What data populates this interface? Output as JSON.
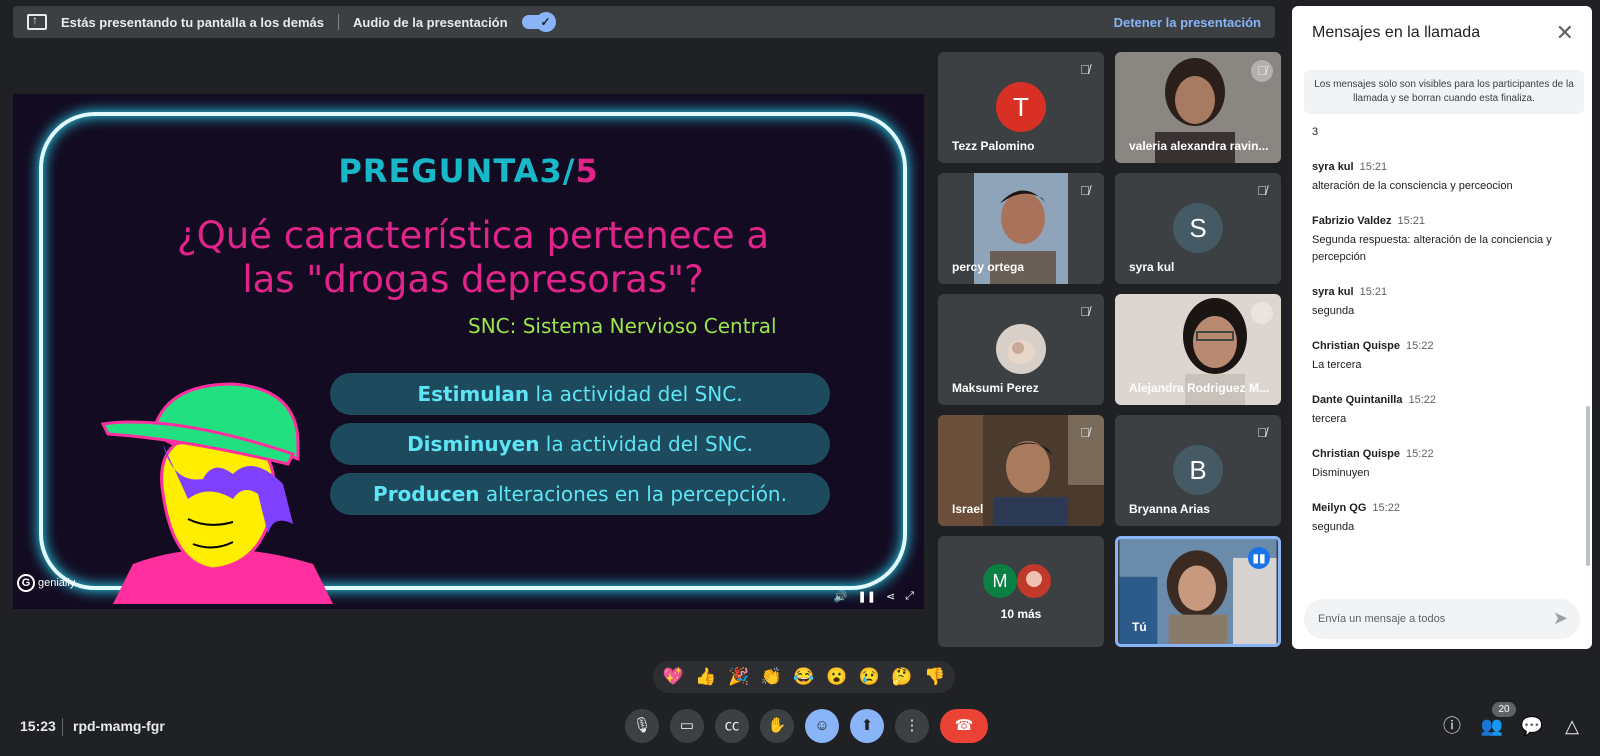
{
  "topbar": {
    "presenting_msg": "Estás presentando tu pantalla a los demás",
    "audio_label": "Audio de la presentación",
    "stop_label": "Detener la presentación"
  },
  "slide": {
    "title_prefix": "PREGUNTA",
    "title_num": "3/",
    "title_den": "5",
    "question": "¿Qué característica pertenece a las \"drogas depresoras\"?",
    "snc_note": "SNC: Sistema Nervioso Central",
    "answers": [
      {
        "bold": "Estimulan",
        "rest": " la actividad del SNC."
      },
      {
        "bold": "Disminuyen",
        "rest": " la actividad del SNC."
      },
      {
        "bold": "Producen",
        "rest": " alteraciones en la percepción."
      }
    ],
    "brand": "genially"
  },
  "participants": [
    {
      "name": "Tezz Palomino",
      "initial": "T",
      "color": "#d93025"
    },
    {
      "name": "valeria alexandra ravin...",
      "video": true
    },
    {
      "name": "percy ortega",
      "video": true
    },
    {
      "name": "syra kul",
      "initial": "S",
      "color": "#455a64"
    },
    {
      "name": "Maksumi Perez",
      "video": true
    },
    {
      "name": "Alejandra Rodriguez M...",
      "video": true
    },
    {
      "name": "Israel",
      "video": true
    },
    {
      "name": "Bryanna Arias",
      "initial": "B",
      "color": "#455a64"
    },
    {
      "name": "10 más",
      "initial": "M",
      "color": "#0b8043"
    },
    {
      "name": "Tú",
      "video": true
    }
  ],
  "chat": {
    "header": "Mensajes en la llamada",
    "note": "Los mensajes solo son visibles para los participantes de la llamada y se borran cuando esta finaliza.",
    "orphan": "3",
    "messages": [
      {
        "sender": "syra kul",
        "time": "15:21",
        "text": "alteración de la consciencia y perceocion"
      },
      {
        "sender": "Fabrizio Valdez",
        "time": "15:21",
        "text": "Segunda respuesta: alteración de la conciencia y percepción"
      },
      {
        "sender": "syra kul",
        "time": "15:21",
        "text": "segunda"
      },
      {
        "sender": "Christian Quispe",
        "time": "15:22",
        "text": "La tercera"
      },
      {
        "sender": "Dante Quintanilla",
        "time": "15:22",
        "text": "tercera"
      },
      {
        "sender": "Christian Quispe",
        "time": "15:22",
        "text": "Disminuyen"
      },
      {
        "sender": "Meilyn QG",
        "time": "15:22",
        "text": "segunda"
      }
    ],
    "input_placeholder": "Envía un mensaje a todos"
  },
  "reactions": [
    "💖",
    "👍",
    "🎉",
    "👏",
    "😂",
    "😮",
    "😢",
    "🤔",
    "👎"
  ],
  "bottom": {
    "time": "15:23",
    "meeting_code": "rpd-mamg-fgr",
    "people_count": "20"
  }
}
